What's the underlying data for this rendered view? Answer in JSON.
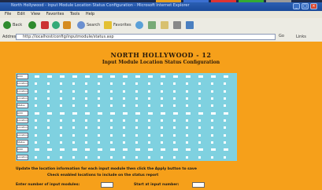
{
  "window": {
    "title": "North Hollywood - Input Module Location Status Configuration - Microsoft Internet Explorer"
  },
  "menu": [
    "File",
    "Edit",
    "View",
    "Favorites",
    "Tools",
    "Help"
  ],
  "toolbar": {
    "back": "Back",
    "search": "Search",
    "favorites": "Favorites"
  },
  "address": {
    "label": "Address",
    "url": "http://localhost/config/inputmodule/status.asp",
    "go": "Go",
    "links": "Links"
  },
  "page": {
    "title": "NORTH HOLLYWOOD - 12",
    "subtitle": "Input Module Location Status Configuration"
  },
  "grid": {
    "row_labels": [
      "Addr",
      "Location",
      "Location",
      "Location",
      "Status",
      "Addr",
      "Location",
      "Location",
      "Location",
      "Status",
      "Addr",
      "Location"
    ]
  },
  "footer": {
    "note1": "Update the location information for each input module then click the Apply button to save",
    "note2": "Check enabled locations to include on the status report",
    "field1_label": "Enter number of input modules:",
    "field2_label": "Start at input number:"
  },
  "colors": {
    "background": "#f6a01a",
    "grid": "#7fd1e0",
    "titlebar": "#2b5fb3"
  }
}
